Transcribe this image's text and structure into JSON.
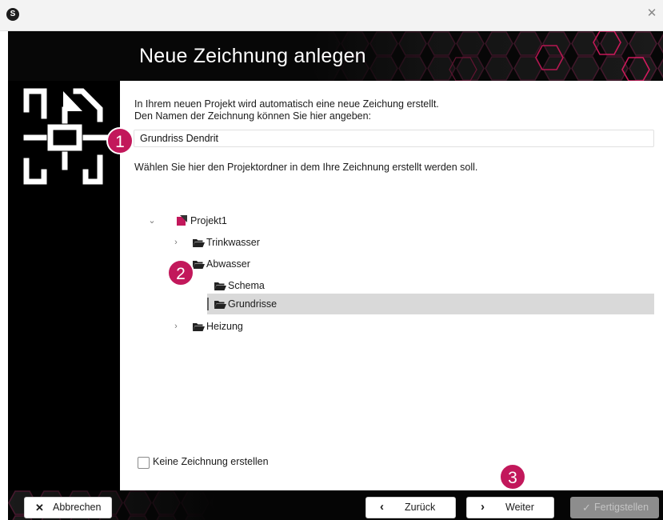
{
  "window": {
    "app_icon_letter": "S",
    "close_glyph": "✕"
  },
  "dialog": {
    "title": "Neue Zeichnung anlegen",
    "intro_line1": "In Ihrem neuen Projekt wird automatisch eine neue Zeichung erstellt.",
    "intro_line2": "Den Namen der Zeichnung können Sie hier angeben:",
    "drawing_name_value": "Grundriss Dendrit",
    "folder_prompt": "Wählen Sie hier den Projektordner in dem Ihre Zeichnung erstellt werden soll.",
    "tree": {
      "project": "Projekt1",
      "trinkwasser": "Trinkwasser",
      "abwasser": "Abwasser",
      "schema": "Schema",
      "grundrisse": "Grundrisse",
      "heizung": "Heizung"
    },
    "no_drawing_label": "Keine Zeichnung erstellen",
    "accent_color": "#c2185b"
  },
  "footer": {
    "cancel_label": "Abbrechen",
    "back_label": "Zurück",
    "next_label": "Weiter",
    "finish_label": "Fertigstellen"
  },
  "callouts": {
    "one": "1",
    "two": "2",
    "three": "3"
  }
}
